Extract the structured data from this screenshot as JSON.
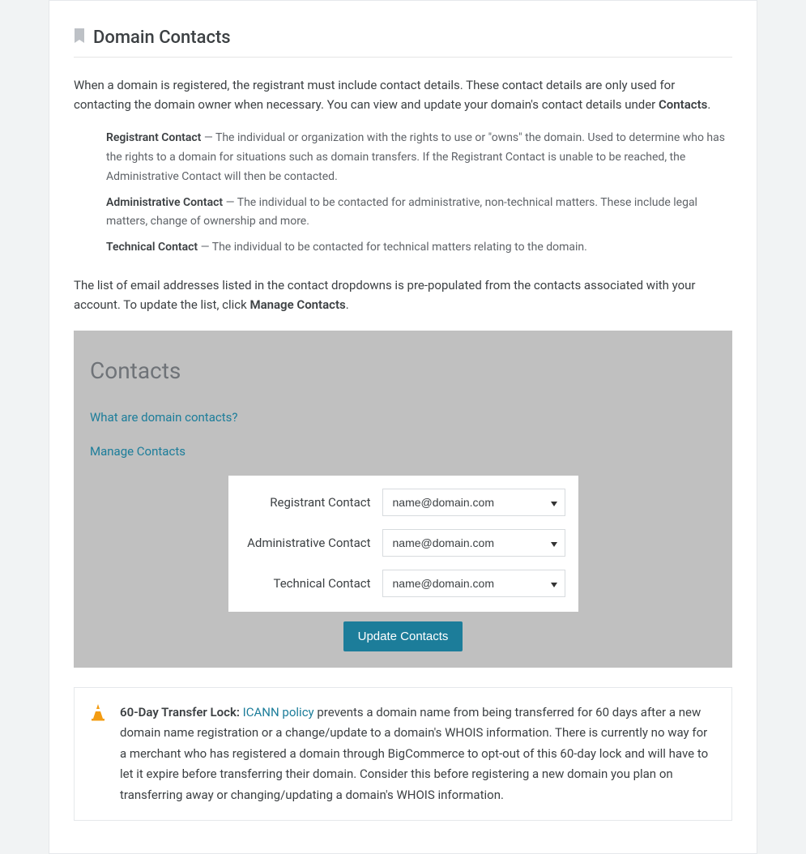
{
  "section": {
    "title": "Domain Contacts",
    "intro_part1": "When a domain is registered, the registrant must include contact details. These contact details are only used for contacting the domain owner when necessary. You can view and update your domain's contact details under ",
    "intro_bold": "Contacts",
    "intro_part2": ".",
    "definitions": [
      {
        "label": "Registrant Contact",
        "text": " — The individual or organization with the rights to use or \"owns\" the domain. Used to determine who has the rights to a domain for situations such as domain transfers. If the Registrant Contact is unable to be reached, the Administrative Contact will then be contacted."
      },
      {
        "label": "Administrative Contact",
        "text": " — The individual to be contacted for administrative, non-technical matters. These include legal matters, change of ownership and more."
      },
      {
        "label": "Technical Contact",
        "text": " — The individual to be contacted for technical matters relating to the domain."
      }
    ],
    "note_part1": "The list of email addresses listed in the contact dropdowns is pre-populated from the contacts associated with your account. To update the list, click ",
    "note_bold": "Manage Contacts",
    "note_part2": "."
  },
  "panel": {
    "title": "Contacts",
    "link_what": "What are domain contacts?",
    "link_manage": "Manage Contacts",
    "rows": {
      "registrant_label": "Registrant Contact",
      "administrative_label": "Administrative Contact",
      "technical_label": "Technical Contact",
      "value": "name@domain.com"
    },
    "update_button": "Update Contacts"
  },
  "callout": {
    "prefix": "60-Day Transfer Lock: ",
    "link": "ICANN policy",
    "text": " prevents a domain name from being transferred for 60 days after a new domain name registration or a change/update to a domain's WHOIS information. There is currently no way for a merchant who has registered a domain through BigCommerce to opt-out of this 60-day lock and will have to let it expire before transferring their domain. Consider this before registering a new domain you plan on transferring away or changing/updating a domain's WHOIS information."
  }
}
